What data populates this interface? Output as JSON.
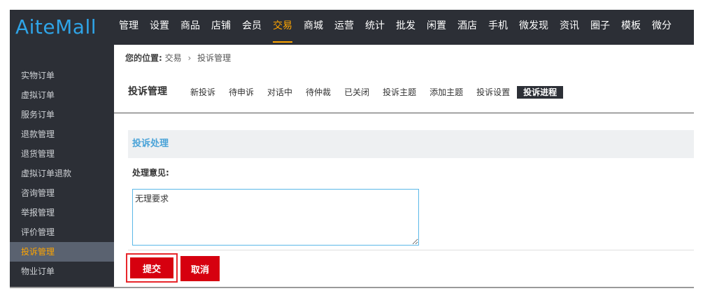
{
  "header": {
    "logo": "AiteMall",
    "nav": [
      {
        "label": "管理",
        "active": false
      },
      {
        "label": "设置",
        "active": false
      },
      {
        "label": "商品",
        "active": false
      },
      {
        "label": "店铺",
        "active": false
      },
      {
        "label": "会员",
        "active": false
      },
      {
        "label": "交易",
        "active": true
      },
      {
        "label": "商城",
        "active": false
      },
      {
        "label": "运营",
        "active": false
      },
      {
        "label": "统计",
        "active": false
      },
      {
        "label": "批发",
        "active": false
      },
      {
        "label": "闲置",
        "active": false
      },
      {
        "label": "酒店",
        "active": false
      },
      {
        "label": "手机",
        "active": false
      },
      {
        "label": "微发现",
        "active": false
      },
      {
        "label": "资讯",
        "active": false
      },
      {
        "label": "圈子",
        "active": false
      },
      {
        "label": "模板",
        "active": false
      },
      {
        "label": "微分",
        "active": false
      }
    ],
    "accent_color": "#ffa500",
    "logo_color": "#2fa4e7"
  },
  "sidebar": {
    "items": [
      {
        "label": "实物订单",
        "active": false
      },
      {
        "label": "虚拟订单",
        "active": false
      },
      {
        "label": "服务订单",
        "active": false
      },
      {
        "label": "退款管理",
        "active": false
      },
      {
        "label": "退货管理",
        "active": false
      },
      {
        "label": "虚拟订单退款",
        "active": false
      },
      {
        "label": "咨询管理",
        "active": false
      },
      {
        "label": "举报管理",
        "active": false
      },
      {
        "label": "评价管理",
        "active": false
      },
      {
        "label": "投诉管理",
        "active": true
      },
      {
        "label": "物业订单",
        "active": false
      }
    ]
  },
  "breadcrumb": {
    "label": "您的位置:",
    "items": [
      "交易",
      "投诉管理"
    ],
    "separator": "›"
  },
  "page": {
    "title": "投诉管理",
    "tabs": [
      {
        "label": "新投诉",
        "active": false
      },
      {
        "label": "待申诉",
        "active": false
      },
      {
        "label": "对话中",
        "active": false
      },
      {
        "label": "待仲裁",
        "active": false
      },
      {
        "label": "已关闭",
        "active": false
      },
      {
        "label": "投诉主题",
        "active": false
      },
      {
        "label": "添加主题",
        "active": false
      },
      {
        "label": "投诉设置",
        "active": false
      },
      {
        "label": "投诉进程",
        "active": true
      }
    ]
  },
  "form": {
    "section_title": "投诉处理",
    "opinion_label": "处理意见:",
    "opinion_value": "无理要求",
    "submit_label": "提交",
    "cancel_label": "取消",
    "button_color": "#d6000f"
  }
}
